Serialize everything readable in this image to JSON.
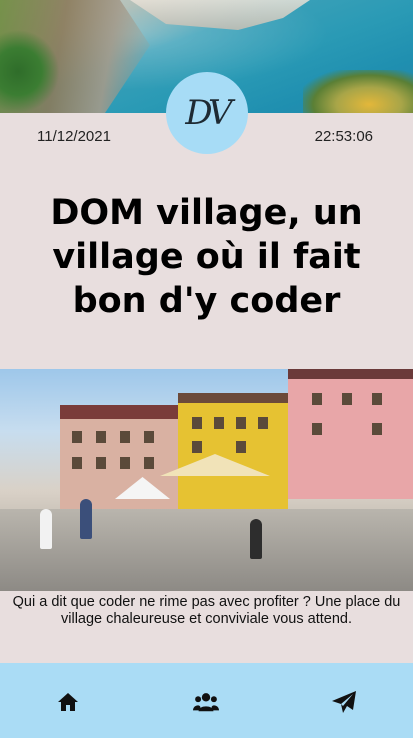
{
  "header": {
    "logo_text": "DV",
    "date": "11/12/2021",
    "time": "22:53:06"
  },
  "article": {
    "title": "DOM village, un village où il fait bon d'y coder",
    "caption": "Qui a dit que coder ne rime pas avec profiter ? Une place du village chaleureuse et conviviale vous attend."
  },
  "navbar": {
    "items": [
      {
        "icon": "home-icon"
      },
      {
        "icon": "users-icon"
      },
      {
        "icon": "send-icon"
      }
    ]
  },
  "colors": {
    "background": "#e8dede",
    "accent": "#aadcf5",
    "text": "#000000"
  }
}
